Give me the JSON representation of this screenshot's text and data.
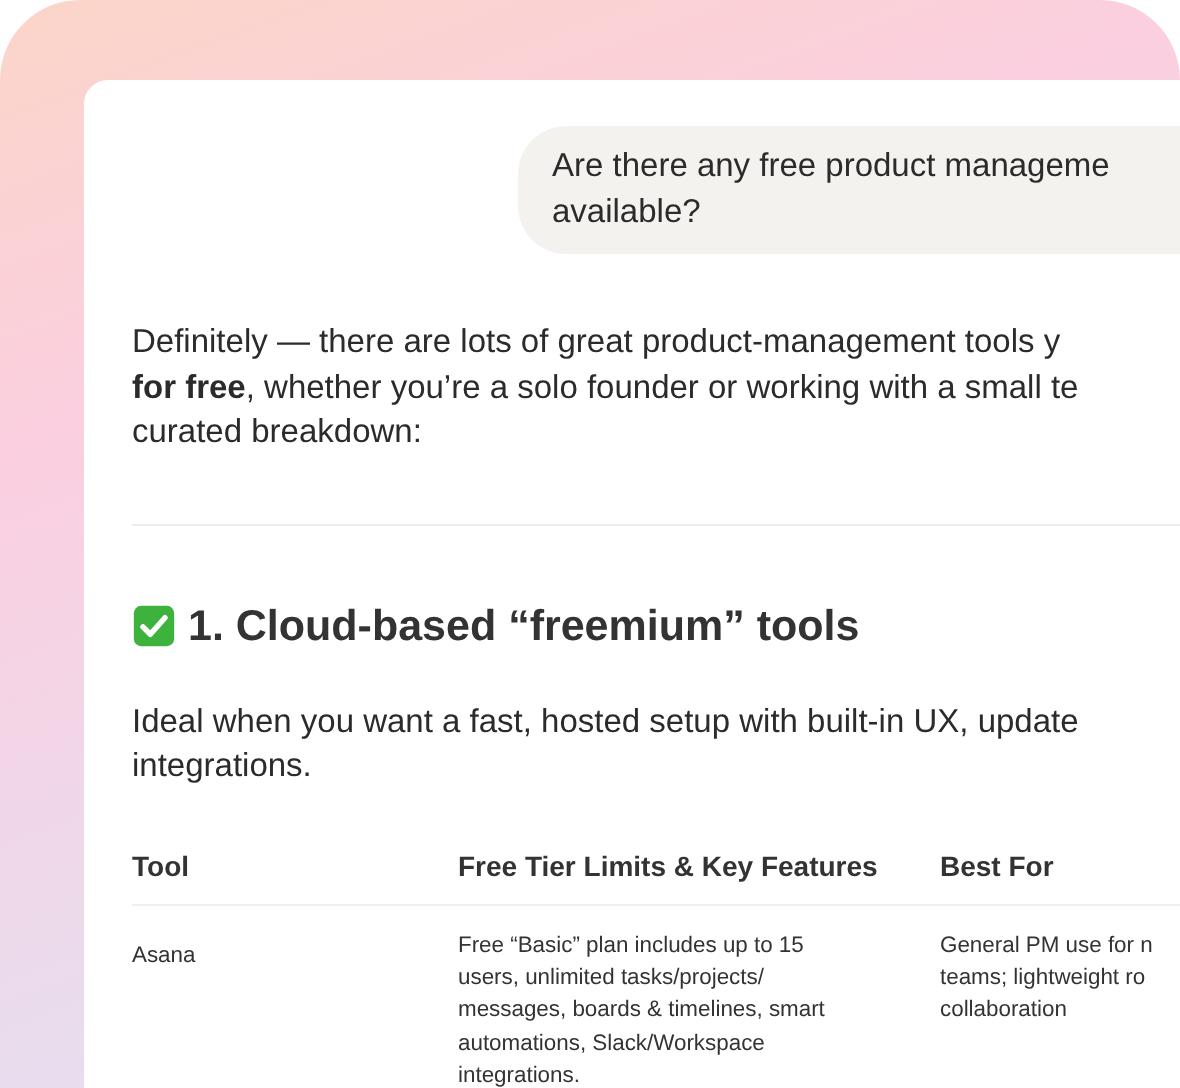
{
  "user_message": {
    "lines": [
      "Are there any free product manageme",
      "available?"
    ]
  },
  "answer": {
    "intro_lines": [
      "Definitely — there are lots of great product-management tools y",
      "**for free**, whether you’re a solo founder or working with a small te",
      "curated breakdown:"
    ],
    "section_heading": "1. Cloud-based “freemium” tools",
    "section_lines": [
      "Ideal when you want a fast, hosted setup with built-in UX, update",
      "integrations."
    ],
    "table": {
      "columns": [
        "Tool",
        "Free Tier Limits & Key Features",
        "Best For"
      ],
      "rows": [
        {
          "cells": [
            [
              "Asana"
            ],
            [
              "Free “Basic” plan includes up to 15",
              "users, unlimited tasks/projects/",
              "messages, boards & timelines, smart",
              "automations, Slack/Workspace",
              "integrations."
            ],
            [
              "General PM use for n",
              "teams; lightweight ro",
              "collaboration"
            ]
          ]
        }
      ]
    }
  }
}
